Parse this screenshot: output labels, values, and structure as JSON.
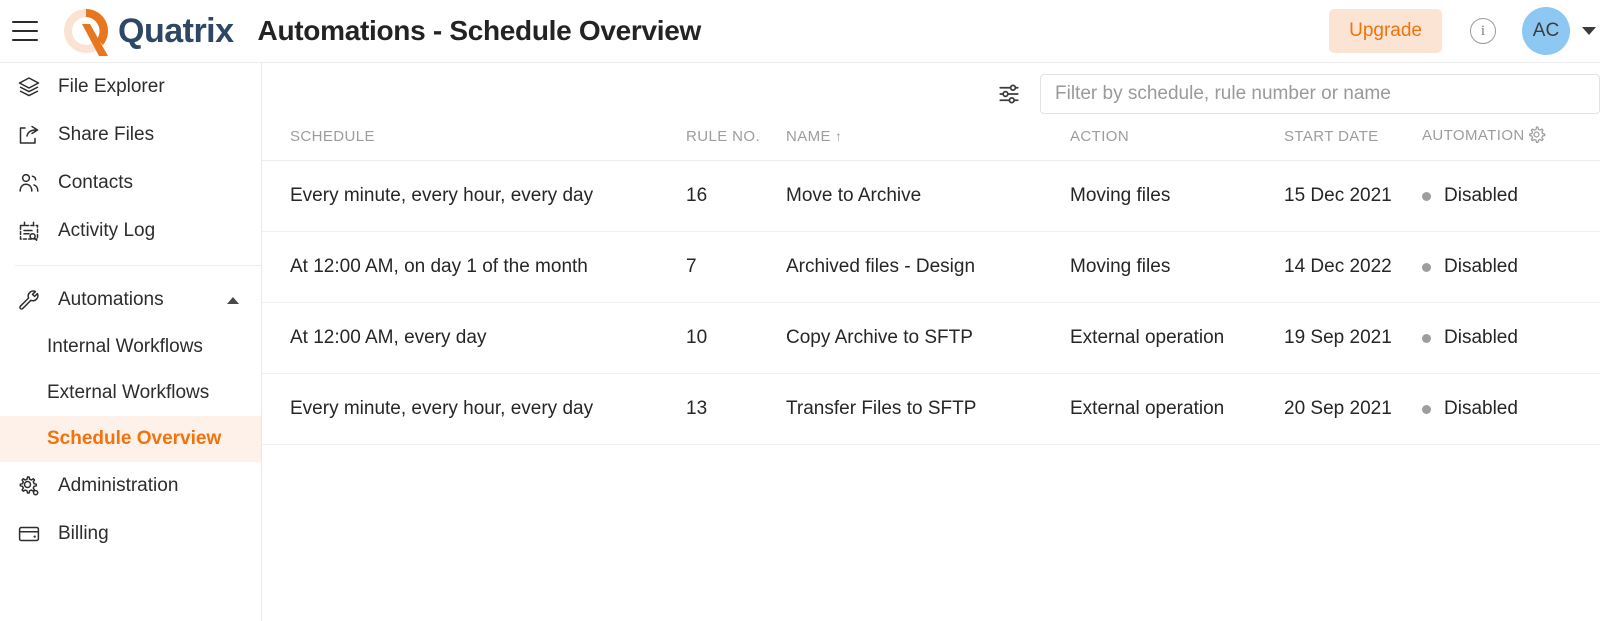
{
  "header": {
    "menu_icon": "hamburger-icon",
    "brand": "Quatrix",
    "title": "Automations - Schedule Overview",
    "upgrade_label": "Upgrade",
    "info_icon": "info-icon",
    "avatar_initials": "AC",
    "caret_icon": "chevron-down-icon",
    "accent_color": "#f2720c",
    "upgrade_bg": "#fbe4d4",
    "avatar_bg": "#8dc8f2",
    "brand_text_color": "#2e4764"
  },
  "sidebar": {
    "items": [
      {
        "label": "File Explorer",
        "icon": "layers-icon"
      },
      {
        "label": "Share Files",
        "icon": "share-icon"
      },
      {
        "label": "Contacts",
        "icon": "people-icon"
      },
      {
        "label": "Activity Log",
        "icon": "calendar-search-icon"
      }
    ],
    "automations": {
      "label": "Automations",
      "icon": "wrench-icon",
      "chevron": "chevron-up-icon"
    },
    "sub_items": [
      {
        "label": "Internal Workflows",
        "active": false
      },
      {
        "label": "External Workflows",
        "active": false
      },
      {
        "label": "Schedule Overview",
        "active": true
      }
    ],
    "bottom_items": [
      {
        "label": "Administration",
        "icon": "gear-icon"
      },
      {
        "label": "Billing",
        "icon": "credit-card-icon"
      }
    ],
    "active_bg": "#fdf1e9",
    "active_color": "#f2720c"
  },
  "toolbar": {
    "filter_icon": "sliders-icon",
    "search_placeholder": "Filter by schedule, rule number or name",
    "search_value": ""
  },
  "table": {
    "columns": [
      {
        "key": "schedule",
        "label": "SCHEDULE"
      },
      {
        "key": "rule_no",
        "label": "RULE NO."
      },
      {
        "key": "name",
        "label": "NAME",
        "sort": "↑"
      },
      {
        "key": "action",
        "label": "ACTION"
      },
      {
        "key": "start_date",
        "label": "START DATE"
      },
      {
        "key": "automation",
        "label": "AUTOMATION",
        "gear": "gear-icon"
      }
    ],
    "rows": [
      {
        "schedule": "Every minute, every hour, every day",
        "rule_no": "16",
        "name": "Move to Archive",
        "action": "Moving files",
        "start_date": "15 Dec 2021",
        "automation": "Disabled"
      },
      {
        "schedule": "At 12:00 AM, on day 1 of the month",
        "rule_no": "7",
        "name": "Archived files - Design",
        "action": "Moving files",
        "start_date": "14 Dec 2022",
        "automation": "Disabled"
      },
      {
        "schedule": "At 12:00 AM, every day",
        "rule_no": "10",
        "name": "Copy Archive to SFTP",
        "action": "External operation",
        "start_date": "19 Sep 2021",
        "automation": "Disabled"
      },
      {
        "schedule": "Every minute, every hour, every day",
        "rule_no": "13",
        "name": "Transfer Files to SFTP",
        "action": "External operation",
        "start_date": "20 Sep 2021",
        "automation": "Disabled"
      }
    ],
    "status_dot_color": "#9e9e9e"
  }
}
